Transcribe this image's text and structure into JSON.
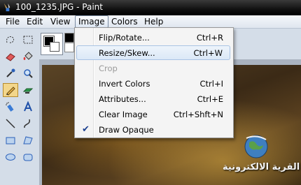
{
  "window": {
    "title": "100_1235.JPG - Paint"
  },
  "menubar": {
    "items": [
      "File",
      "Edit",
      "View",
      "Image",
      "Colors",
      "Help"
    ],
    "active": "Image"
  },
  "image_menu": {
    "items": [
      {
        "label": "Flip/Rotate...",
        "shortcut": "Ctrl+R"
      },
      {
        "label": "Resize/Skew...",
        "shortcut": "Ctrl+W"
      },
      {
        "label": "Crop",
        "shortcut": ""
      },
      {
        "label": "Invert Colors",
        "shortcut": "Ctrl+I"
      },
      {
        "label": "Attributes...",
        "shortcut": "Ctrl+E"
      },
      {
        "label": "Clear Image",
        "shortcut": "Ctrl+Shft+N"
      },
      {
        "label": "Draw Opaque",
        "shortcut": ""
      }
    ],
    "highlighted": "Resize/Skew...",
    "disabled": "Crop",
    "checked": "Draw Opaque"
  },
  "toolbox": {
    "tools": [
      "free-select-icon",
      "rect-select-icon",
      "eraser-icon",
      "fill-icon",
      "eyedropper-icon",
      "magnifier-icon",
      "pencil-icon",
      "brush-icon",
      "airbrush-icon",
      "text-icon",
      "line-icon",
      "curve-icon",
      "rectangle-icon",
      "polygon-icon",
      "ellipse-icon",
      "rounded-rect-icon"
    ],
    "selected": "pencil-icon"
  },
  "colors": {
    "foreground": "#000000",
    "background": "#ffffff",
    "accent": "#1a3f8f"
  },
  "watermark": {
    "text": "القرية الالكترونية"
  }
}
